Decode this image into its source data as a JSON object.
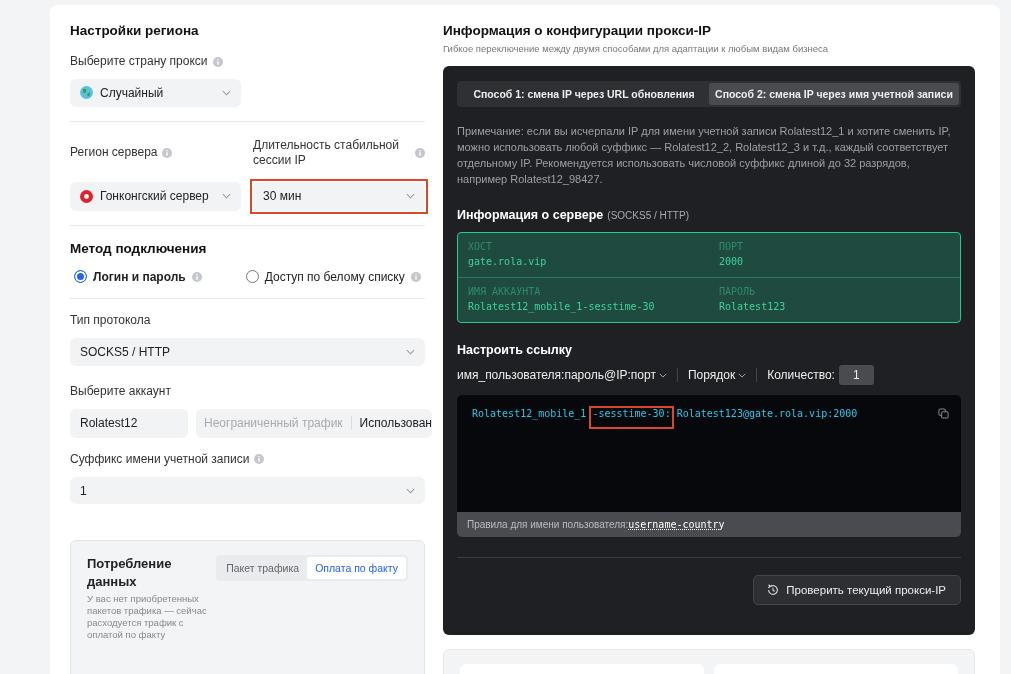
{
  "region_settings": {
    "title": "Настройки региона",
    "country": {
      "label": "Выберите страну прокси",
      "value": "Случайный"
    },
    "server_region": {
      "label": "Регион сервера",
      "value": "Гонконгский сервер"
    },
    "session_duration": {
      "label": "Длительность стабильной сессии IP",
      "value": "30 мин",
      "highlighted": true
    }
  },
  "connection_method": {
    "title": "Метод подключения",
    "options": [
      {
        "label": "Логин и пароль",
        "selected": true
      },
      {
        "label": "Доступ по белому списку",
        "selected": false
      }
    ]
  },
  "protocol": {
    "label": "Тип протокола",
    "value": "SOCKS5 / HTTP"
  },
  "account": {
    "label": "Выберите аккаунт",
    "value": "Rolatest12",
    "traffic": "Неограниченный трафик",
    "usage": "Использован"
  },
  "suffix": {
    "label": "Суффикс имени учетной записи",
    "value": "1"
  },
  "consumption": {
    "title": "Потребление данных",
    "tabs": [
      {
        "label": "Пакет трафика",
        "selected": false
      },
      {
        "label": "Оплата по факту",
        "selected": true
      }
    ],
    "note": "У вас нет приобретенных пакетов трафика — сейчас расходуется трафик с оплатой по факту"
  },
  "config": {
    "title": "Информация о конфигурации прокси-IP",
    "subtitle": "Гибкое переключение между двумя способами для адаптации к любым видам бизнеса",
    "methods": [
      {
        "label": "Способ 1: смена IP через URL обновления",
        "selected": false
      },
      {
        "label": "Способ 2: смена IP через имя учетной записи",
        "selected": true
      }
    ],
    "note": "Примечание: если вы исчерпали IP для имени учетной записи Rolatest12_1 и хотите сменить IP, можно использовать любой суффикс — Rolatest12_2, Rolatest12_3 и т.д., каждый соответствует отдельному IP. Рекомендуется использовать числовой суффикс длиной до 32 разрядов, например Rolatest12_98427.",
    "server_info": {
      "title": "Информация о сервере",
      "subtitle": "(SOCKS5 / HTTP)",
      "fields": [
        {
          "label": "ХОСТ",
          "value": "gate.rola.vip"
        },
        {
          "label": "ПОРТ",
          "value": "2000"
        },
        {
          "label": "ИМЯ АККАУНТА",
          "value": "Rolatest12_mobile_1-sesstime-30"
        },
        {
          "label": "ПАРОЛЬ",
          "value": "Rolatest123"
        }
      ]
    },
    "link": {
      "title": "Настроить ссылку",
      "format": "имя_пользователя:пароль@IP:порт",
      "order": "Порядок",
      "quantity_label": "Количество:",
      "quantity": "1",
      "parts": [
        {
          "text": "Rolatest12_mobile_1",
          "highlighted": false
        },
        {
          "text": "-sesstime-30:",
          "highlighted": true
        },
        {
          "text": "Rolatest123@gate.rola.vip:2000",
          "highlighted": false
        }
      ],
      "rule_label": "Правила для имени пользователя:",
      "rule_value": "username-country"
    },
    "check_button": "Проверить текущий прокси-IP"
  }
}
